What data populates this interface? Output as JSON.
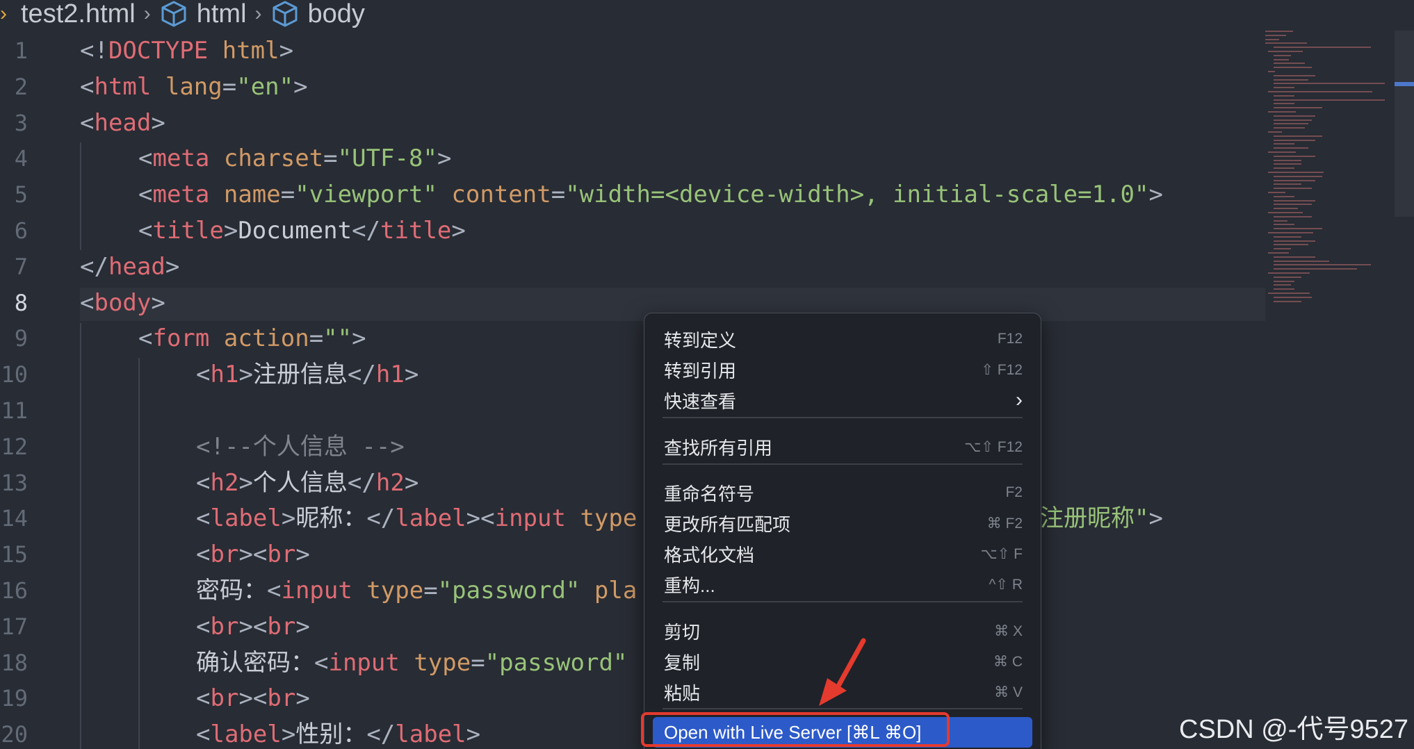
{
  "breadcrumb": {
    "file": "test2.html",
    "items": [
      "html",
      "body"
    ]
  },
  "editor": {
    "active_line": 8,
    "lines": [
      {
        "n": "1",
        "tokens": [
          {
            "t": "pun",
            "v": "<!"
          },
          {
            "t": "tag",
            "v": "DOCTYPE"
          },
          {
            "t": "txt",
            "v": " "
          },
          {
            "t": "attr",
            "v": "html"
          },
          {
            "t": "pun",
            "v": ">"
          }
        ]
      },
      {
        "n": "2",
        "tokens": [
          {
            "t": "pun",
            "v": "<"
          },
          {
            "t": "tag",
            "v": "html"
          },
          {
            "t": "txt",
            "v": " "
          },
          {
            "t": "attr",
            "v": "lang"
          },
          {
            "t": "pun",
            "v": "="
          },
          {
            "t": "str",
            "v": "\"en\""
          },
          {
            "t": "pun",
            "v": ">"
          }
        ]
      },
      {
        "n": "3",
        "tokens": [
          {
            "t": "pun",
            "v": "<"
          },
          {
            "t": "tag",
            "v": "head"
          },
          {
            "t": "pun",
            "v": ">"
          }
        ]
      },
      {
        "n": "4",
        "tokens": [
          {
            "t": "pun",
            "v": "<"
          },
          {
            "t": "tag",
            "v": "meta"
          },
          {
            "t": "txt",
            "v": " "
          },
          {
            "t": "attr",
            "v": "charset"
          },
          {
            "t": "pun",
            "v": "="
          },
          {
            "t": "str",
            "v": "\"UTF-8\""
          },
          {
            "t": "pun",
            "v": ">"
          }
        ]
      },
      {
        "n": "5",
        "tokens": [
          {
            "t": "pun",
            "v": "<"
          },
          {
            "t": "tag",
            "v": "meta"
          },
          {
            "t": "txt",
            "v": " "
          },
          {
            "t": "attr",
            "v": "name"
          },
          {
            "t": "pun",
            "v": "="
          },
          {
            "t": "str",
            "v": "\"viewport\""
          },
          {
            "t": "txt",
            "v": " "
          },
          {
            "t": "attr",
            "v": "content"
          },
          {
            "t": "pun",
            "v": "="
          },
          {
            "t": "str",
            "v": "\"width=<device-width>, initial-scale=1.0\""
          },
          {
            "t": "pun",
            "v": ">"
          }
        ]
      },
      {
        "n": "6",
        "tokens": [
          {
            "t": "pun",
            "v": "<"
          },
          {
            "t": "tag",
            "v": "title"
          },
          {
            "t": "pun",
            "v": ">"
          },
          {
            "t": "txt",
            "v": "Document"
          },
          {
            "t": "pun",
            "v": "</"
          },
          {
            "t": "tag",
            "v": "title"
          },
          {
            "t": "pun",
            "v": ">"
          }
        ]
      },
      {
        "n": "7",
        "tokens": [
          {
            "t": "pun",
            "v": "</"
          },
          {
            "t": "tag",
            "v": "head"
          },
          {
            "t": "pun",
            "v": ">"
          }
        ]
      },
      {
        "n": "8",
        "tokens": [
          {
            "t": "pun",
            "v": "<"
          },
          {
            "t": "tag",
            "v": "body"
          },
          {
            "t": "pun",
            "v": ">"
          }
        ]
      },
      {
        "n": "9",
        "tokens": [
          {
            "t": "pun",
            "v": "<"
          },
          {
            "t": "tag",
            "v": "form"
          },
          {
            "t": "txt",
            "v": " "
          },
          {
            "t": "attr",
            "v": "action"
          },
          {
            "t": "pun",
            "v": "="
          },
          {
            "t": "str",
            "v": "\"\""
          },
          {
            "t": "pun",
            "v": ">"
          }
        ]
      },
      {
        "n": "10",
        "tokens": [
          {
            "t": "pun",
            "v": "<"
          },
          {
            "t": "tag",
            "v": "h1"
          },
          {
            "t": "pun",
            "v": ">"
          },
          {
            "t": "txt",
            "v": "注册信息"
          },
          {
            "t": "pun",
            "v": "</"
          },
          {
            "t": "tag",
            "v": "h1"
          },
          {
            "t": "pun",
            "v": ">"
          }
        ]
      },
      {
        "n": "11",
        "tokens": []
      },
      {
        "n": "12",
        "tokens": [
          {
            "t": "com",
            "v": "<!--个人信息 -->"
          }
        ]
      },
      {
        "n": "13",
        "tokens": [
          {
            "t": "pun",
            "v": "<"
          },
          {
            "t": "tag",
            "v": "h2"
          },
          {
            "t": "pun",
            "v": ">"
          },
          {
            "t": "txt",
            "v": "个人信息"
          },
          {
            "t": "pun",
            "v": "</"
          },
          {
            "t": "tag",
            "v": "h2"
          },
          {
            "t": "pun",
            "v": ">"
          }
        ]
      },
      {
        "n": "14",
        "tokens": [
          {
            "t": "pun",
            "v": "<"
          },
          {
            "t": "tag",
            "v": "label"
          },
          {
            "t": "pun",
            "v": ">"
          },
          {
            "t": "txt",
            "v": "昵称："
          },
          {
            "t": "pun",
            "v": "</"
          },
          {
            "t": "tag",
            "v": "label"
          },
          {
            "t": "pun",
            "v": "><"
          },
          {
            "t": "tag",
            "v": "input"
          },
          {
            "t": "txt",
            "v": " "
          },
          {
            "t": "attr",
            "v": "type"
          }
        ]
      },
      {
        "n": "15",
        "tokens": [
          {
            "t": "pun",
            "v": "<"
          },
          {
            "t": "tag",
            "v": "br"
          },
          {
            "t": "pun",
            "v": "><"
          },
          {
            "t": "tag",
            "v": "br"
          },
          {
            "t": "pun",
            "v": ">"
          }
        ]
      },
      {
        "n": "16",
        "tokens": [
          {
            "t": "txt",
            "v": "密码："
          },
          {
            "t": "pun",
            "v": "<"
          },
          {
            "t": "tag",
            "v": "input"
          },
          {
            "t": "txt",
            "v": " "
          },
          {
            "t": "attr",
            "v": "type"
          },
          {
            "t": "pun",
            "v": "="
          },
          {
            "t": "str",
            "v": "\"password\""
          },
          {
            "t": "txt",
            "v": " "
          },
          {
            "t": "attr",
            "v": "pla"
          }
        ]
      },
      {
        "n": "17",
        "tokens": [
          {
            "t": "pun",
            "v": "<"
          },
          {
            "t": "tag",
            "v": "br"
          },
          {
            "t": "pun",
            "v": "><"
          },
          {
            "t": "tag",
            "v": "br"
          },
          {
            "t": "pun",
            "v": ">"
          }
        ]
      },
      {
        "n": "18",
        "tokens": [
          {
            "t": "txt",
            "v": "确认密码："
          },
          {
            "t": "pun",
            "v": "<"
          },
          {
            "t": "tag",
            "v": "input"
          },
          {
            "t": "txt",
            "v": " "
          },
          {
            "t": "attr",
            "v": "type"
          },
          {
            "t": "pun",
            "v": "="
          },
          {
            "t": "str",
            "v": "\"password\""
          }
        ]
      },
      {
        "n": "19",
        "tokens": [
          {
            "t": "pun",
            "v": "<"
          },
          {
            "t": "tag",
            "v": "br"
          },
          {
            "t": "pun",
            "v": "><"
          },
          {
            "t": "tag",
            "v": "br"
          },
          {
            "t": "pun",
            "v": ">"
          }
        ]
      },
      {
        "n": "20",
        "tokens": [
          {
            "t": "pun",
            "v": "<"
          },
          {
            "t": "tag",
            "v": "label"
          },
          {
            "t": "pun",
            "v": ">"
          },
          {
            "t": "txt",
            "v": "性别："
          },
          {
            "t": "pun",
            "v": "</"
          },
          {
            "t": "tag",
            "v": "label"
          },
          {
            "t": "pun",
            "v": ">"
          }
        ]
      }
    ],
    "line14_tail": [
      {
        "t": "str",
        "v": "注册昵称\""
      },
      {
        "t": "pun",
        "v": ">"
      }
    ]
  },
  "context_menu": {
    "items": [
      {
        "label": "转到定义",
        "shortcut": "F12"
      },
      {
        "label": "转到引用",
        "shortcut": "⇧ F12"
      },
      {
        "label": "快速查看",
        "shortcut": "›"
      },
      {
        "label": "查找所有引用",
        "shortcut": "⌥⇧ F12"
      },
      {
        "label": "重命名符号",
        "shortcut": "F2"
      },
      {
        "label": "更改所有匹配项",
        "shortcut": "⌘ F2"
      },
      {
        "label": "格式化文档",
        "shortcut": "⌥⇧ F"
      },
      {
        "label": "重构...",
        "shortcut": "^⇧ R"
      },
      {
        "label": "剪切",
        "shortcut": "⌘ X"
      },
      {
        "label": "复制",
        "shortcut": "⌘ C"
      },
      {
        "label": "粘贴",
        "shortcut": "⌘ V"
      }
    ],
    "live_server": "Open with Live Server [⌘L ⌘O]"
  },
  "watermark": "CSDN @-代号9527",
  "colors": {
    "background": "#282c34",
    "tag": "#e06c75",
    "attribute": "#d19a66",
    "string": "#98c379",
    "menu_highlight": "#2c5ac9",
    "annotation_red": "#e53a2e"
  }
}
